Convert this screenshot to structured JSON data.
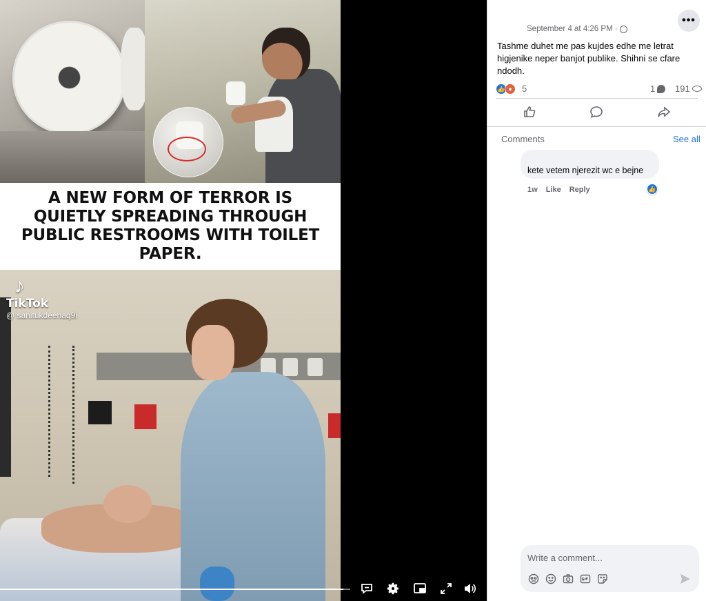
{
  "video": {
    "headline": "A NEW FORM OF TERROR IS QUIETLY SPREADING THROUGH PUBLIC RESTROOMS WITH TOILET PAPER.",
    "watermark": {
      "brand": "TikTok",
      "handle": "@ sanitukdeenaq9i"
    },
    "progress": 0.98
  },
  "post": {
    "meta": "September 4 at 4:26 PM ·",
    "text": "Tashme duhet me pas kujdes edhe me letrat higjenike neper banjot publike. Shihni se cfare ndodh.",
    "reaction_count": "5",
    "comment_count": "1",
    "view_count": "191"
  },
  "comments": {
    "label": "Comments",
    "see_all": "See all",
    "items": [
      {
        "text": "kete vetem njerezit wc e bejne",
        "time": "1w",
        "like": "Like",
        "reply": "Reply"
      }
    ]
  },
  "composer": {
    "placeholder": "Write a comment..."
  },
  "colors": {
    "accent": "#1b74e4",
    "muted": "#65676b",
    "bubble_bg": "#f0f2f5"
  },
  "icons": {
    "more": "more-options-icon",
    "like": "thumbs-up-icon",
    "comment": "comment-icon",
    "share": "share-icon",
    "captions": "captions-icon",
    "settings": "gear-icon",
    "pip": "picture-in-picture-icon",
    "fullscreen": "fullscreen-icon",
    "volume": "volume-icon"
  }
}
